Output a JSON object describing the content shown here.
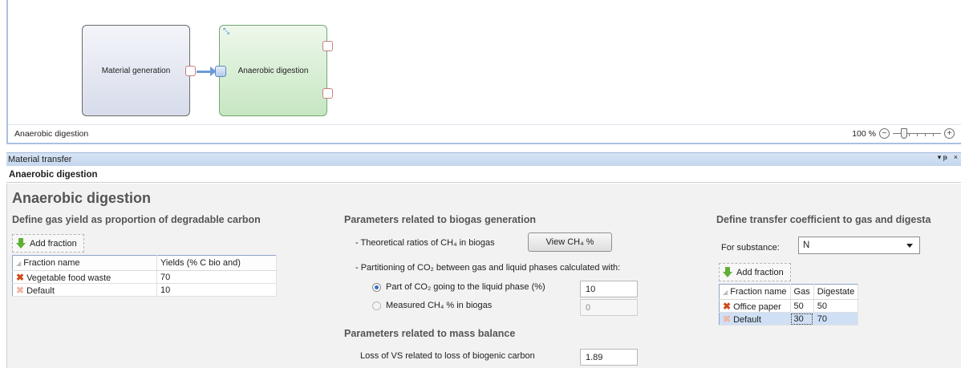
{
  "canvas": {
    "nodes": [
      {
        "label": "Material generation"
      },
      {
        "label": "Anaerobic digestion"
      }
    ],
    "status_text": "Anaerobic digestion",
    "zoom_label": "100 %"
  },
  "panel": {
    "title": "Material transfer",
    "subtitle": "Anaerobic digestion",
    "controls": {
      "pin": "▾ ᵽ",
      "close": "×"
    }
  },
  "main": {
    "heading": "Anaerobic digestion",
    "gas_yield": {
      "heading": "Define gas yield as proportion of degradable carbon",
      "add_label": "Add fraction",
      "columns": [
        "Fraction name",
        "Yields (% C bio and)"
      ],
      "rows": [
        {
          "name": "Vegetable food waste",
          "value": "70"
        },
        {
          "name": "Default",
          "value": "10"
        }
      ]
    },
    "biogas": {
      "heading": "Parameters related to biogas generation",
      "ratio_label": "- Theoretical ratios of CH₄ in biogas",
      "view_button": "View CH₄ %",
      "partition_label": "- Partitioning of CO₂ between gas and liquid phases calculated with:",
      "option_co2_label": "Part of CO₂ going to the liquid phase (%)",
      "option_co2_value": "10",
      "option_ch4_label": "Measured CH₄ % in biogas",
      "option_ch4_value": "0"
    },
    "mass_balance": {
      "heading": "Parameters related to mass balance",
      "loss_label": "Loss of VS related to loss of biogenic carbon",
      "loss_value": "1.89"
    },
    "transfer": {
      "heading": "Define transfer coefficient to gas and digesta",
      "substance_label": "For substance:",
      "substance_value": "N",
      "add_label": "Add fraction",
      "columns": [
        "Fraction name",
        "Gas",
        "Digestate"
      ],
      "rows": [
        {
          "name": "Office paper",
          "gas": "50",
          "digestate": "50"
        },
        {
          "name": "Default",
          "gas": "30",
          "digestate": "70"
        }
      ]
    }
  },
  "colors": {
    "accent": "#2f6fc7",
    "remove": "#d04a1a",
    "add": "#5fb035"
  }
}
